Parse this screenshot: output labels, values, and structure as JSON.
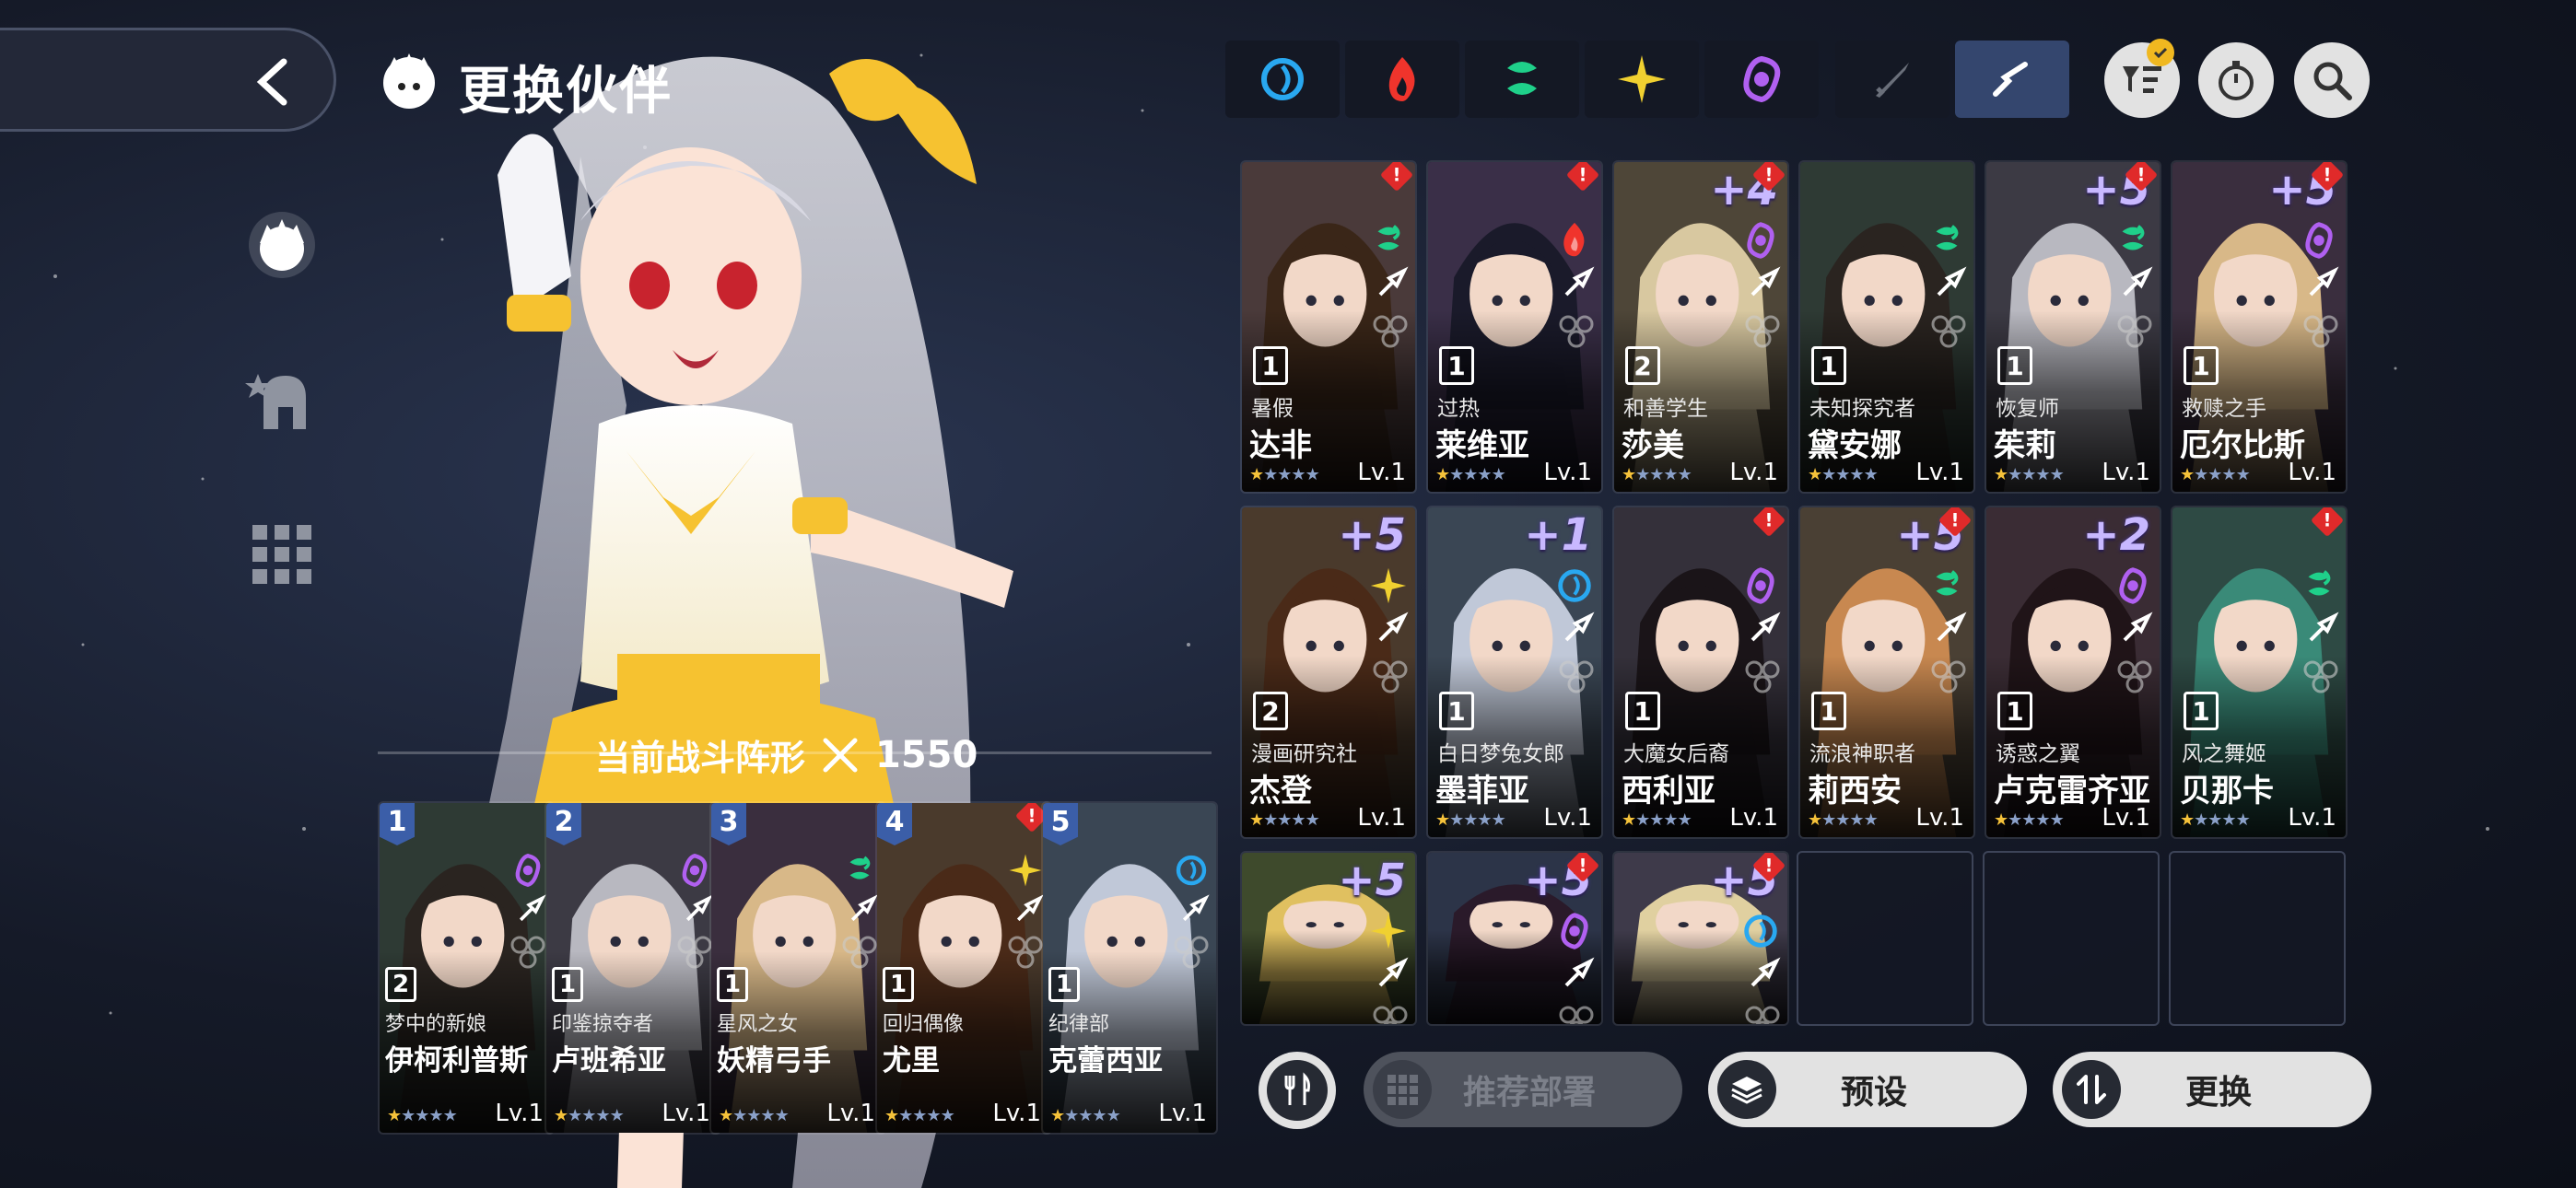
{
  "header": {
    "title": "更换伙伴"
  },
  "formation": {
    "label": "当前战斗阵形",
    "power": "1550"
  },
  "team": [
    {
      "slot": "1",
      "rank": "2",
      "title": "梦中的新娘",
      "name": "伊柯利普斯",
      "lv": "Lv.1",
      "stars": 1,
      "element": "purple"
    },
    {
      "slot": "2",
      "rank": "1",
      "title": "印鉴掠夺者",
      "name": "卢班希亚",
      "lv": "Lv.1",
      "stars": 1,
      "element": "purple"
    },
    {
      "slot": "3",
      "rank": "1",
      "title": "星风之女",
      "name": "妖精弓手",
      "lv": "Lv.1",
      "stars": 1,
      "element": "green"
    },
    {
      "slot": "4",
      "rank": "1",
      "title": "回归偶像",
      "name": "尤里",
      "lv": "Lv.1",
      "stars": 1,
      "element": "gold"
    },
    {
      "slot": "5",
      "rank": "1",
      "title": "纪律部",
      "name": "克蕾西亚",
      "lv": "Lv.1",
      "stars": 1,
      "element": "blue"
    }
  ],
  "filters": [
    {
      "name": "water",
      "color": "#29a8f0"
    },
    {
      "name": "fire",
      "color": "#f0342c"
    },
    {
      "name": "wind",
      "color": "#1fd08a"
    },
    {
      "name": "light",
      "color": "#f0d030"
    },
    {
      "name": "dark",
      "color": "#b060f0"
    },
    {
      "name": "sword",
      "color": "#6a6f7a"
    },
    {
      "name": "pose",
      "color": "#ffffff"
    }
  ],
  "roster": [
    {
      "plus": "",
      "rank": "1",
      "title": "暑假",
      "name": "达非",
      "lv": "Lv.1",
      "stars": 1,
      "element": "green",
      "alert": true
    },
    {
      "plus": "",
      "rank": "1",
      "title": "过热",
      "name": "莱维亚",
      "lv": "Lv.1",
      "stars": 1,
      "element": "red",
      "alert": true
    },
    {
      "plus": "+4",
      "rank": "2",
      "title": "和善学生",
      "name": "莎美",
      "lv": "Lv.1",
      "stars": 1,
      "element": "purple",
      "alert": true
    },
    {
      "plus": "",
      "rank": "1",
      "title": "未知探究者",
      "name": "黛安娜",
      "lv": "Lv.1",
      "stars": 1,
      "element": "green",
      "alert": false
    },
    {
      "plus": "+5",
      "rank": "1",
      "title": "恢复师",
      "name": "茱莉",
      "lv": "Lv.1",
      "stars": 1,
      "element": "green",
      "alert": true
    },
    {
      "plus": "+5",
      "rank": "1",
      "title": "救赎之手",
      "name": "厄尔比斯",
      "lv": "Lv.1",
      "stars": 1,
      "element": "purple",
      "alert": true
    },
    {
      "plus": "+5",
      "rank": "2",
      "title": "漫画研究社",
      "name": "杰登",
      "lv": "Lv.1",
      "stars": 1,
      "element": "gold",
      "alert": false
    },
    {
      "plus": "+1",
      "rank": "1",
      "title": "白日梦兔女郎",
      "name": "墨菲亚",
      "lv": "Lv.1",
      "stars": 1,
      "element": "blue",
      "alert": false
    },
    {
      "plus": "",
      "rank": "1",
      "title": "大魔女后裔",
      "name": "西利亚",
      "lv": "Lv.1",
      "stars": 1,
      "element": "purple",
      "alert": true
    },
    {
      "plus": "+5",
      "rank": "1",
      "title": "流浪神职者",
      "name": "莉西安",
      "lv": "Lv.1",
      "stars": 1,
      "element": "green",
      "alert": true
    },
    {
      "plus": "+2",
      "rank": "1",
      "title": "诱惑之翼",
      "name": "卢克雷齐亚",
      "lv": "Lv.1",
      "stars": 1,
      "element": "purple",
      "alert": false
    },
    {
      "plus": "",
      "rank": "1",
      "title": "风之舞姬",
      "name": "贝那卡",
      "lv": "Lv.1",
      "stars": 1,
      "element": "green",
      "alert": true
    },
    {
      "plus": "+5",
      "rank": "",
      "title": "",
      "name": "",
      "lv": "",
      "stars": 0,
      "element": "gold",
      "alert": false
    },
    {
      "plus": "+5",
      "rank": "",
      "title": "",
      "name": "",
      "lv": "",
      "stars": 0,
      "element": "purple",
      "alert": true
    },
    {
      "plus": "+5",
      "rank": "",
      "title": "",
      "name": "",
      "lv": "",
      "stars": 0,
      "element": "blue",
      "alert": true
    }
  ],
  "bottom": {
    "recommend_label": "推荐部署",
    "preset_label": "预设",
    "change_label": "更换"
  },
  "colors": {
    "water": "#29a8f0",
    "fire": "#f0342c",
    "wind": "#1fd08a",
    "light": "#f0d030",
    "dark": "#b060f0"
  }
}
